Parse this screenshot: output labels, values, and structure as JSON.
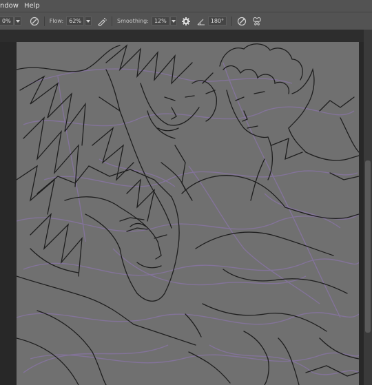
{
  "menu": {
    "items": [
      "ndow",
      "Help"
    ]
  },
  "options": {
    "opacity_value": "0%",
    "flow_label": "Flow:",
    "flow_value": "62%",
    "smoothing_label": "Smoothing:",
    "smoothing_value": "12%",
    "angle_value": "180°"
  },
  "icons": {
    "pressure_opacity": "pen-pressure-opacity-icon",
    "airbrush": "airbrush-icon",
    "smoothing_settings": "gear-icon",
    "angle": "angle-icon",
    "pressure_size": "pen-pressure-size-icon",
    "symmetry": "butterfly-symmetry-icon"
  },
  "colors": {
    "canvas_bg": "#707070",
    "line_art": "#1e1e1e",
    "sketch": "#8a74a8",
    "ui_bar": "#535353",
    "workspace": "#282828"
  }
}
